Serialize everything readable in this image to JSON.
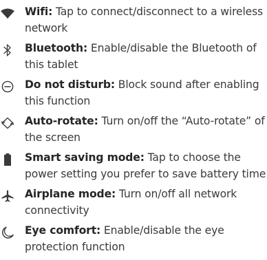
{
  "features": [
    {
      "icon": "wifi-icon",
      "title": "Wifi:",
      "description": " Tap to connect/disconnect to a wireless network"
    },
    {
      "icon": "bluetooth-icon",
      "title": "Bluetooth:",
      "description": " Enable/disable the Bluetooth of this tablet"
    },
    {
      "icon": "do-not-disturb-icon",
      "title": "Do not disturb:",
      "description": " Block sound after enabling this function"
    },
    {
      "icon": "auto-rotate-icon",
      "title": "Auto-rotate:",
      "description": " Turn on/off the “Auto-rotate” of the screen"
    },
    {
      "icon": "battery-icon",
      "title": "Smart saving mode:",
      "description": " Tap to choose the power setting you prefer to save battery time"
    },
    {
      "icon": "airplane-icon",
      "title": "Airplane mode:",
      "description": " Turn on/off all network connectivity"
    },
    {
      "icon": "eye-comfort-icon",
      "title": "Eye comfort:",
      "description": " Enable/disable the eye protection function"
    }
  ],
  "colors": {
    "text": "#3a3a3a",
    "title": "#262626",
    "icon": "#3a3a3a"
  }
}
